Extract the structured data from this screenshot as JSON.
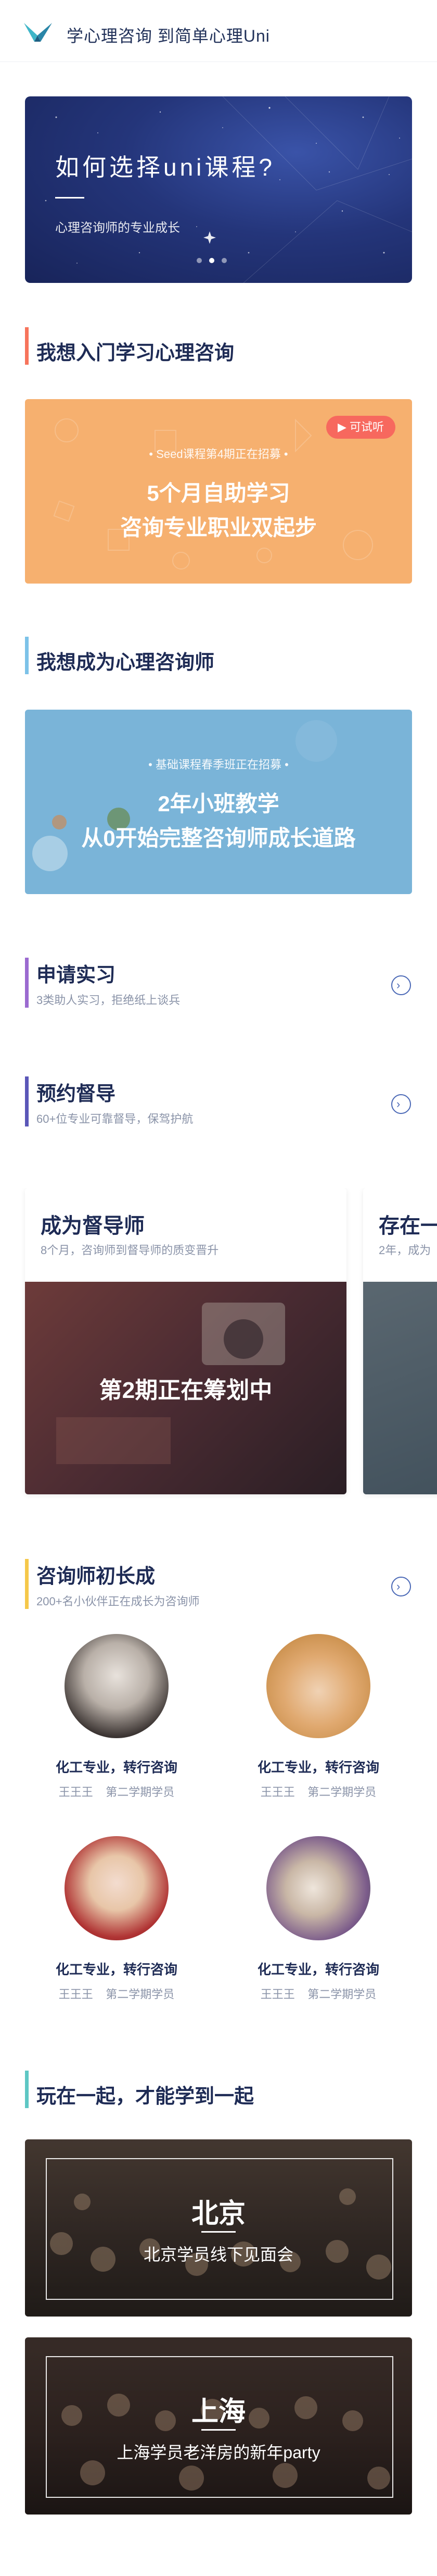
{
  "header": {
    "title": "学心理咨询 到简单心理Uni"
  },
  "hero": {
    "title": "如何选择uni课程?",
    "subtitle": "心理咨询师的专业成长",
    "slide_count": 3,
    "active_slide": 1
  },
  "sections": {
    "intro": {
      "title": "我想入门学习心理咨询",
      "bar_color": "#f7745c"
    },
    "become": {
      "title": "我想成为心理咨询师",
      "bar_color": "#7cc2e8"
    },
    "fun": {
      "title": "玩在一起，才能学到一起",
      "bar_color": "#5ec7c4"
    }
  },
  "course_orange": {
    "badge": "可试听",
    "top_line": "• Seed课程第4期正在招募 •",
    "main_line1": "5个月自助学习",
    "main_line2": "咨询专业职业双起步"
  },
  "course_blue": {
    "top_line": "• 基础课程春季班正在招募 •",
    "main_line1": "2年小班教学",
    "main_line2": "从0开始完整咨询师成长道路"
  },
  "rows": [
    {
      "title": "申请实习",
      "subtitle": "3类助人实习，拒绝纸上谈兵",
      "bar_color": "#9b6ad0"
    },
    {
      "title": "预约督导",
      "subtitle": "60+位专业可靠督导，保驾护航",
      "bar_color": "#5b57b8"
    }
  ],
  "supervisor_cards": [
    {
      "title": "成为督导师",
      "subtitle": "8个月，咨询师到督导师的质变晋升",
      "overlay": "第2期正在筹划中"
    },
    {
      "title": "存在一",
      "subtitle": "2年，成为"
    }
  ],
  "growth": {
    "title": "咨询师初长成",
    "subtitle": "200+名小伙伴正在成长为咨询师",
    "bar_color": "#f5c84a",
    "people": [
      {
        "headline": "化工专业，转行咨询",
        "name": "王王王",
        "cohort": "第二学期学员"
      },
      {
        "headline": "化工专业，转行咨询",
        "name": "王王王",
        "cohort": "第二学期学员"
      },
      {
        "headline": "化工专业，转行咨询",
        "name": "王王王",
        "cohort": "第二学期学员"
      },
      {
        "headline": "化工专业，转行咨询",
        "name": "王王王",
        "cohort": "第二学期学员"
      }
    ]
  },
  "photos": [
    {
      "city": "北京",
      "caption": "北京学员线下见面会"
    },
    {
      "city": "上海",
      "caption": "上海学员老洋房的新年party"
    }
  ],
  "icons": {
    "logo": "uni-logo-icon",
    "chevron": "chevron-right-circle-icon"
  }
}
